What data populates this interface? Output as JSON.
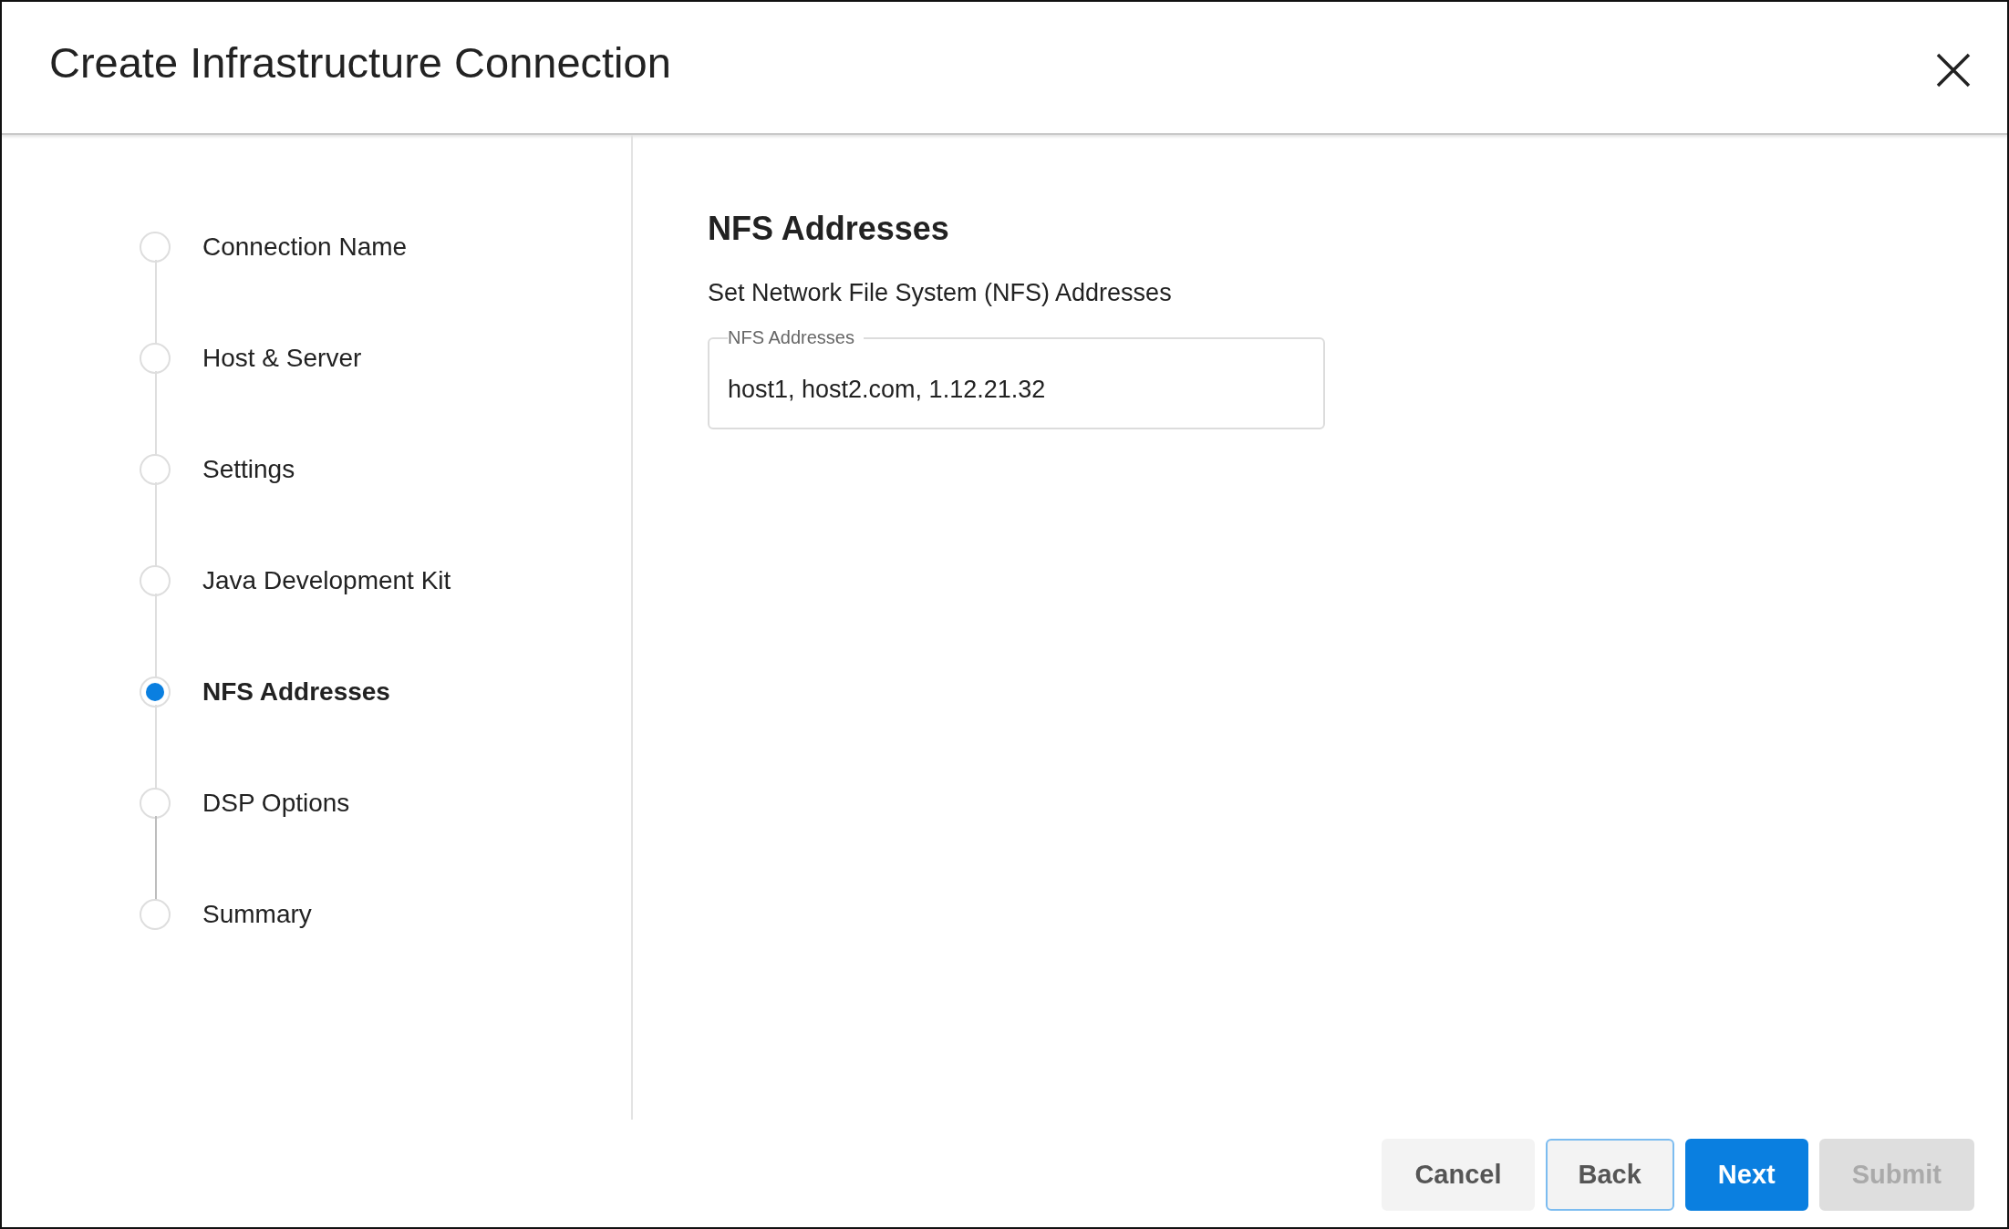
{
  "dialog": {
    "title": "Create Infrastructure Connection"
  },
  "steps": [
    {
      "label": "Connection Name",
      "selected": false
    },
    {
      "label": "Host & Server",
      "selected": false
    },
    {
      "label": "Settings",
      "selected": false
    },
    {
      "label": "Java Development Kit",
      "selected": false
    },
    {
      "label": "NFS Addresses",
      "selected": true
    },
    {
      "label": "DSP Options",
      "selected": false
    },
    {
      "label": "Summary",
      "selected": false
    }
  ],
  "content": {
    "heading": "NFS Addresses",
    "description": "Set Network File System (NFS) Addresses",
    "field": {
      "label": "NFS Addresses",
      "value": "host1, host2.com, 1.12.21.32"
    }
  },
  "buttons": [
    {
      "label": "Cancel",
      "kind": "secondary"
    },
    {
      "label": "Back",
      "kind": "focused"
    },
    {
      "label": "Next",
      "kind": "primary"
    },
    {
      "label": "Submit",
      "kind": "disabled"
    }
  ]
}
